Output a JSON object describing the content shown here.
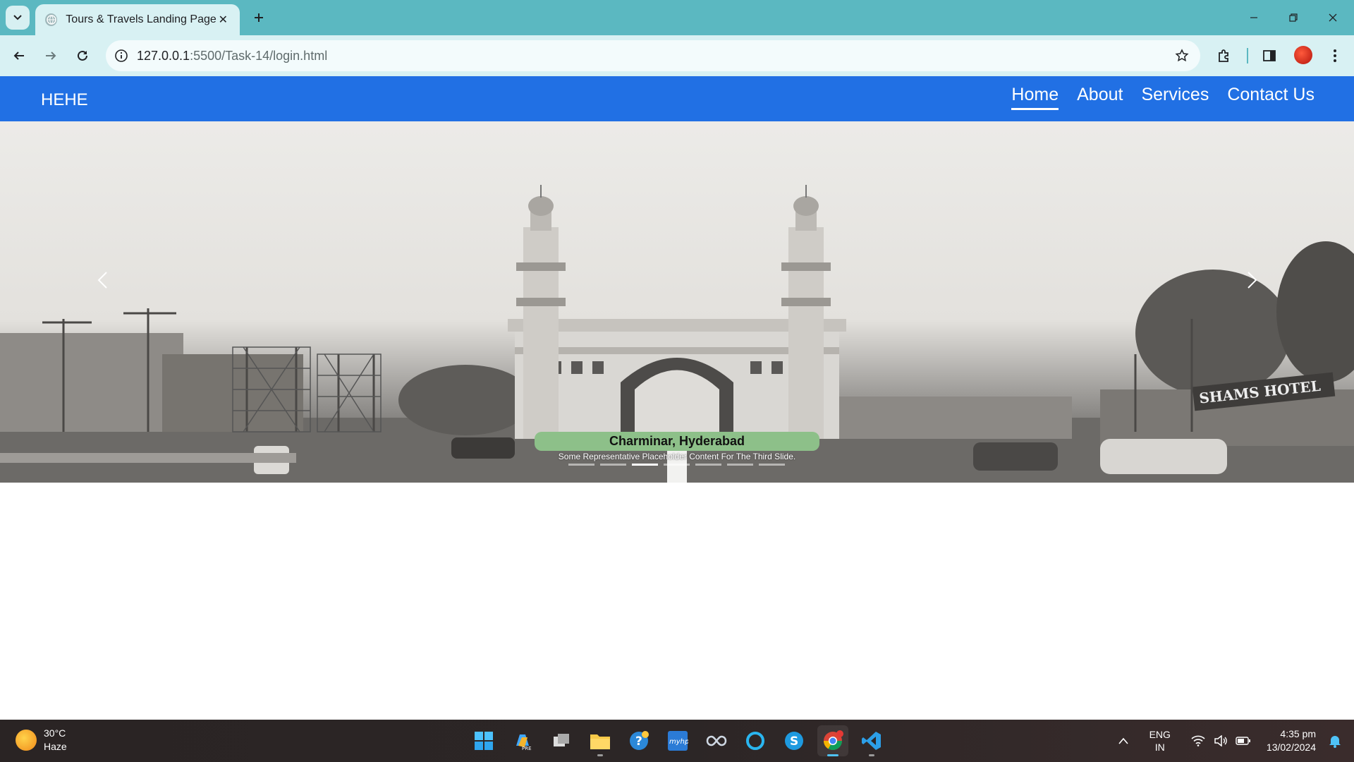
{
  "browser": {
    "tab_title": "Tours & Travels Landing Page",
    "url_host": "127.0.0.1",
    "url_path": ":5500/Task-14/login.html"
  },
  "site": {
    "brand": "HEHE",
    "nav": [
      {
        "label": "Home",
        "active": true
      },
      {
        "label": "About",
        "active": false
      },
      {
        "label": "Services",
        "active": false
      },
      {
        "label": "Contact Us",
        "active": false
      }
    ]
  },
  "carousel": {
    "caption_title": "Charminar, Hyderabad",
    "caption_text": "Some Representative Placeholder Content For The Third Slide.",
    "sign_text": "SHAMS HOTEL",
    "indicator_count": 7,
    "active_index": 2
  },
  "taskbar": {
    "temperature": "30°C",
    "weather": "Haze",
    "lang_top": "ENG",
    "lang_bottom": "IN",
    "time": "4:35 pm",
    "date": "13/02/2024"
  }
}
